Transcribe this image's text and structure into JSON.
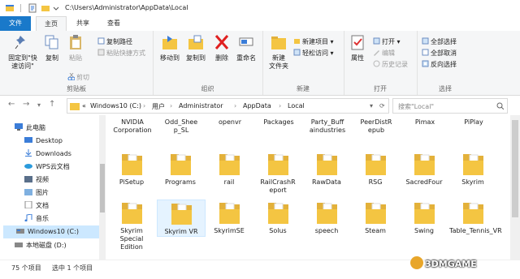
{
  "window": {
    "path_title": "C:\\Users\\Administrator\\AppData\\Local"
  },
  "tabs": [
    "文件",
    "主页",
    "共享",
    "查看"
  ],
  "ribbon": {
    "clipboard": {
      "label": "剪贴板",
      "pin": "固定到\"快\n速访问\"",
      "copy": "复制",
      "paste": "粘贴",
      "copy_path": "复制路径",
      "paste_shortcut": "粘贴快捷方式",
      "cut": "剪切"
    },
    "organize": {
      "label": "组织",
      "move_to": "移动到",
      "copy_to": "复制到",
      "delete": "删除",
      "rename": "重命名"
    },
    "new": {
      "label": "新建",
      "new_folder": "新建\n文件夹",
      "new_item": "新建项目",
      "easy_access": "轻松访问"
    },
    "open": {
      "label": "打开",
      "properties": "属性",
      "open": "打开",
      "edit": "编辑",
      "history": "历史记录"
    },
    "select": {
      "label": "选择",
      "select_all": "全部选择",
      "select_none": "全部取消",
      "invert": "反向选择"
    }
  },
  "address": {
    "crumbs": [
      "Windows10 (C:)",
      "用户",
      "Administrator",
      "AppData",
      "Local"
    ],
    "prefix": "«",
    "search_placeholder": "搜索\"Local\""
  },
  "nav": [
    {
      "label": "此电脑",
      "icon": "computer-icon"
    },
    {
      "label": "Desktop",
      "icon": "desktop-icon"
    },
    {
      "label": "Downloads",
      "icon": "download-icon"
    },
    {
      "label": "WPS云文档",
      "icon": "cloud-icon"
    },
    {
      "label": "视频",
      "icon": "video-icon"
    },
    {
      "label": "图片",
      "icon": "picture-icon"
    },
    {
      "label": "文档",
      "icon": "document-icon"
    },
    {
      "label": "音乐",
      "icon": "music-icon"
    },
    {
      "label": "Windows10 (C:)",
      "icon": "drive-icon"
    },
    {
      "label": "本地磁盘 (D:)",
      "icon": "drive-icon"
    }
  ],
  "top_labels": [
    "NVIDIA\nCorporation",
    "Odd_Shee\np_SL",
    "openvr",
    "Packages",
    "Party_Buff\naindustries",
    "PeerDistR\nepub",
    "Pimax",
    "PiPlay"
  ],
  "row2": [
    "PiSetup",
    "Programs",
    "rail",
    "RailCrashR\neport",
    "RawData",
    "RSG",
    "SacredFour",
    "Skyrim"
  ],
  "row3": [
    "Skyrim\nSpecial\nEdition",
    "Skyrim VR",
    "SkyrimSE",
    "Solus",
    "speech",
    "Steam",
    "Swing",
    "Table_Tennis_VR"
  ],
  "status": {
    "count": "75 个项目",
    "selected": "选中 1 个项目"
  },
  "watermark": "3DMGAME",
  "colors": {
    "accent": "#1979ca",
    "folder": "#f4c542",
    "selection": "#cce8ff"
  }
}
